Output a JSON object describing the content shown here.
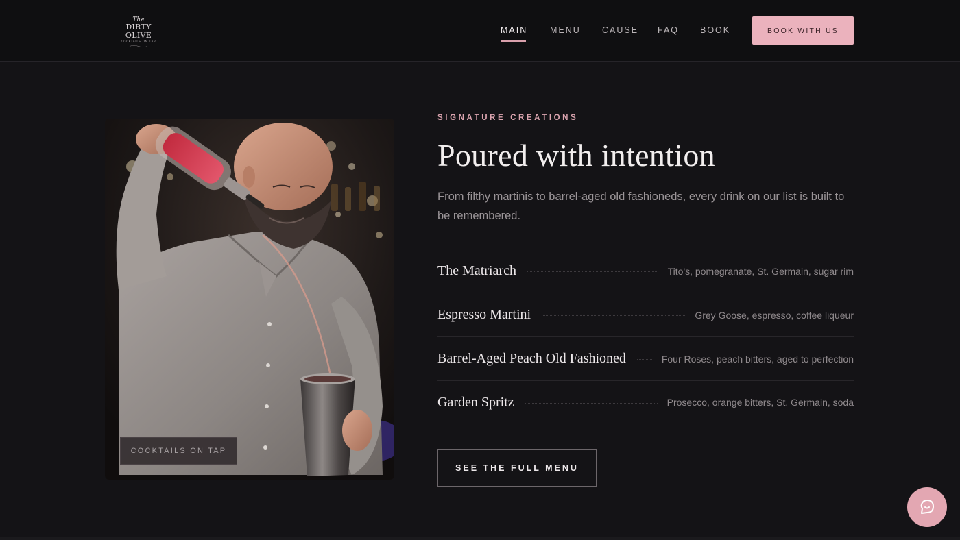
{
  "header": {
    "logo": {
      "line1": "The",
      "line2": "DIRTY OLIVE",
      "tagline": "COCKTAILS ON TAP"
    },
    "nav": [
      {
        "label": "MAIN",
        "active": true
      },
      {
        "label": "MENU",
        "active": false
      },
      {
        "label": "CAUSE",
        "active": false
      },
      {
        "label": "FAQ",
        "active": false
      },
      {
        "label": "BOOK",
        "active": false
      }
    ],
    "cta_label": "BOOK WITH US"
  },
  "photo": {
    "badge": "COCKTAILS ON TAP"
  },
  "section": {
    "eyebrow": "SIGNATURE CREATIONS",
    "title": "Poured with intention",
    "intro": "From filthy martinis to barrel-aged old fashioneds, every drink on our list is built to be remembered.",
    "drinks": [
      {
        "name": "The Matriarch",
        "description": "Tito's, pomegranate, St. Germain, sugar rim"
      },
      {
        "name": "Espresso Martini",
        "description": "Grey Goose, espresso, coffee liqueur"
      },
      {
        "name": "Barrel-Aged Peach Old Fashioned",
        "description": "Four Roses, peach bitters, aged to perfection"
      },
      {
        "name": "Garden Spritz",
        "description": "Prosecco, orange bitters, St. Germain, soda"
      }
    ],
    "cta_label": "SEE THE FULL MENU"
  },
  "chat": {
    "icon": "chat-bubble-icon"
  },
  "colors": {
    "background": "#141316",
    "header": "#0f0f11",
    "accent_pink": "#ebb2bd",
    "eyebrow": "#dba4af"
  }
}
